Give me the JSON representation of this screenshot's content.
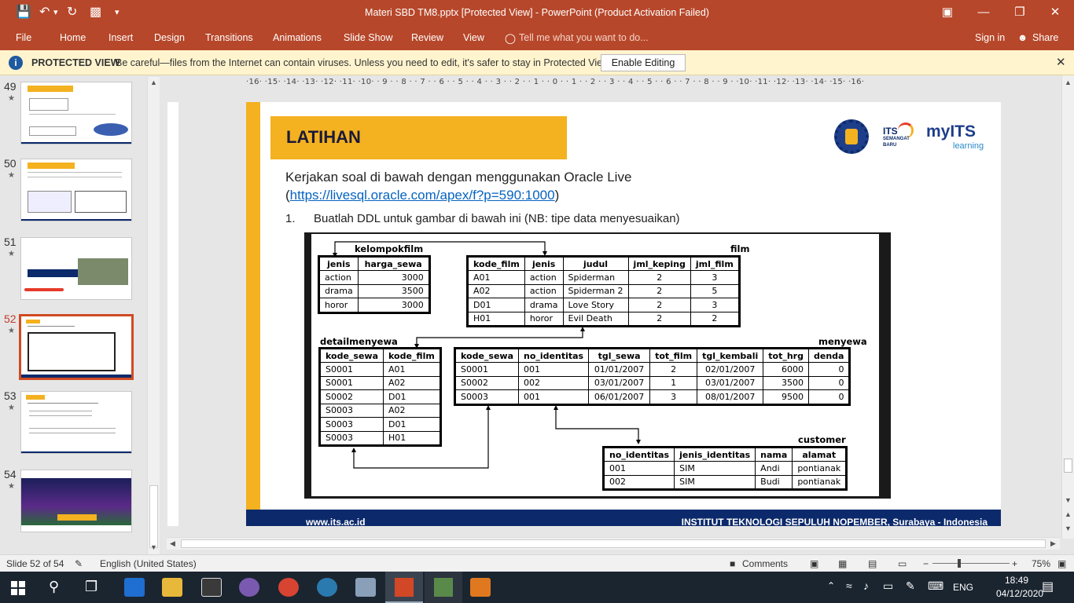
{
  "window": {
    "title": "Materi SBD TM8.pptx [Protected View] - PowerPoint (Product Activation Failed)"
  },
  "menu": {
    "items": [
      "File",
      "Home",
      "Insert",
      "Design",
      "Transitions",
      "Animations",
      "Slide Show",
      "Review",
      "View"
    ],
    "tell_me": "Tell me what you want to do...",
    "sign_in": "Sign in",
    "share": "Share"
  },
  "protected_view": {
    "label": "PROTECTED VIEW",
    "message": "Be careful—files from the Internet can contain viruses. Unless you need to edit, it's safer to stay in Protected View.",
    "button": "Enable Editing"
  },
  "thumbnails": [
    {
      "num": "49",
      "star": "★"
    },
    {
      "num": "50",
      "star": "★"
    },
    {
      "num": "51",
      "star": "★"
    },
    {
      "num": "52",
      "star": "★"
    },
    {
      "num": "53",
      "star": "★"
    },
    {
      "num": "54",
      "star": "★"
    }
  ],
  "ruler": {
    "horizontal": "·16· ·15· ·14· ·13· ·12· ·11· ·10· · 9 · · 8 · · 7 · · 6 · · 5 · · 4 · · 3 · · 2 · · 1 · · 0 · · 1 · · 2 · · 3 · · 4 · · 5 · · 6 · · 7 · · 8 · · 9 · ·10· ·11· ·12· ·13· ·14· ·15· ·16·"
  },
  "slide": {
    "title": "LATIHAN",
    "instruction_line1": "Kerjakan soal di bawah dengan menggunakan Oracle Live",
    "link_open": "(",
    "link": "https://livesql.oracle.com/apex/f?p=590:1000",
    "link_close": ")",
    "item_number": "1.",
    "item_text": "Buatlah DDL untuk gambar di bawah ini (NB: tipe data menyesuaikan)",
    "logo_its_text": "ITS",
    "logo_semangat": "SEMANGAT",
    "logo_baru": "BARU",
    "logo_myits": "myITS",
    "logo_learning": "learning",
    "footer_left": "www.its.ac.id",
    "footer_right": "INSTITUT TEKNOLOGI SEPULUH NOPEMBER, Surabaya - Indonesia",
    "colors": {
      "accent": "#f4b120",
      "navy": "#0c2a6b",
      "link": "#0563c1"
    }
  },
  "diagram": {
    "kelompokfilm": {
      "label": "kelompokfilm",
      "headers": [
        "jenis",
        "harga_sewa"
      ],
      "rows": [
        [
          "action",
          "3000"
        ],
        [
          "drama",
          "3500"
        ],
        [
          "horor",
          "3000"
        ]
      ]
    },
    "film": {
      "label": "film",
      "headers": [
        "kode_film",
        "jenis",
        "judul",
        "jml_keping",
        "jml_film"
      ],
      "rows": [
        [
          "A01",
          "action",
          "Spiderman",
          "2",
          "3"
        ],
        [
          "A02",
          "action",
          "Spiderman 2",
          "2",
          "5"
        ],
        [
          "D01",
          "drama",
          "Love Story",
          "2",
          "3"
        ],
        [
          "H01",
          "horor",
          "Evil Death",
          "2",
          "2"
        ]
      ]
    },
    "detailmenyewa": {
      "label": "detailmenyewa",
      "headers": [
        "kode_sewa",
        "kode_film"
      ],
      "rows": [
        [
          "S0001",
          "A01"
        ],
        [
          "S0001",
          "A02"
        ],
        [
          "S0002",
          "D01"
        ],
        [
          "S0003",
          "A02"
        ],
        [
          "S0003",
          "D01"
        ],
        [
          "S0003",
          "H01"
        ]
      ]
    },
    "menyewa": {
      "label": "menyewa",
      "headers": [
        "kode_sewa",
        "no_identitas",
        "tgl_sewa",
        "tot_film",
        "tgl_kembali",
        "tot_hrg",
        "denda"
      ],
      "rows": [
        [
          "S0001",
          "001",
          "01/01/2007",
          "2",
          "02/01/2007",
          "6000",
          "0"
        ],
        [
          "S0002",
          "002",
          "03/01/2007",
          "1",
          "03/01/2007",
          "3500",
          "0"
        ],
        [
          "S0003",
          "001",
          "06/01/2007",
          "3",
          "08/01/2007",
          "9500",
          "0"
        ]
      ]
    },
    "customer": {
      "label": "customer",
      "headers": [
        "no_identitas",
        "jenis_identitas",
        "nama",
        "alamat"
      ],
      "rows": [
        [
          "001",
          "SIM",
          "Andi",
          "pontianak"
        ],
        [
          "002",
          "SIM",
          "Budi",
          "pontianak"
        ]
      ]
    }
  },
  "status": {
    "slide_info": "Slide 52 of 54",
    "language": "English (United States)",
    "comments": "Comments",
    "zoom": "75%"
  },
  "taskbar": {
    "language": "ENG",
    "time": "18:49",
    "date": "04/12/2020"
  }
}
